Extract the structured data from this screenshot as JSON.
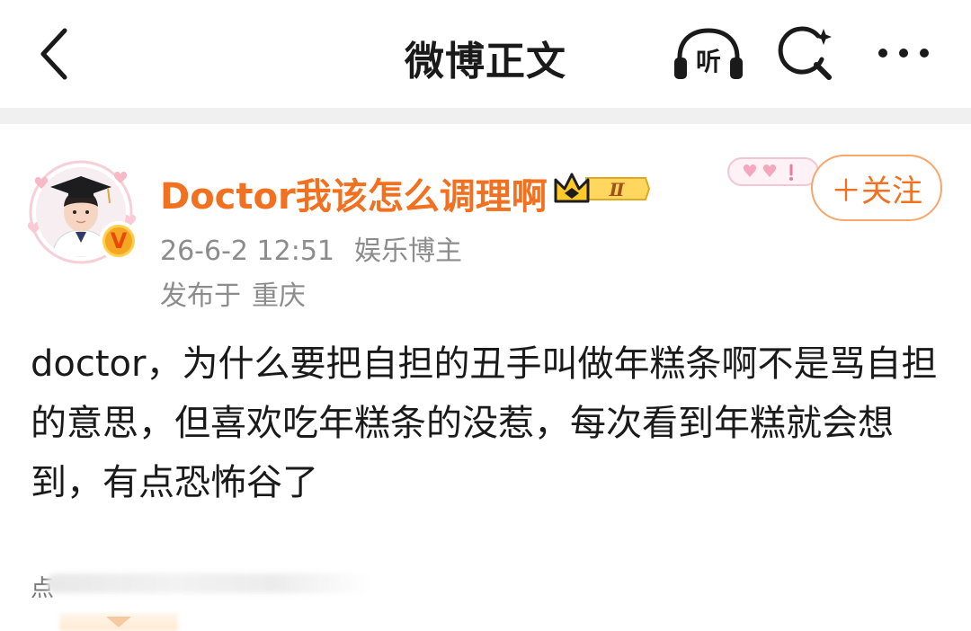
{
  "header": {
    "title": "微博正文",
    "listen_label": "听"
  },
  "post": {
    "author": {
      "name": "Doctor我该怎么调理啊",
      "vip_level": "Ⅱ",
      "verified_mark": "V"
    },
    "follow_label": "＋关注",
    "timestamp": "26-6-2 12:51",
    "author_tag": "娱乐博主",
    "location_prefix": "发布于",
    "location": "重庆",
    "text": "doctor，为什么要把自担的丑手叫做年糕条啊不是骂自担的意思，但喜欢吃年糕条的没惹，每次看到年糕就会想到，有点恐怖谷了",
    "blurred_lead": "点"
  },
  "colors": {
    "accent": "#f27121",
    "text_primary": "#1a1a1a",
    "text_secondary": "#8c8c8c",
    "divider": "#f0f0f0"
  },
  "icons": [
    "back-arrow-icon",
    "headphones-listen-icon",
    "search-sparkle-icon",
    "more-dots-icon",
    "verified-v-icon",
    "crown-icon",
    "hearts-icon"
  ]
}
